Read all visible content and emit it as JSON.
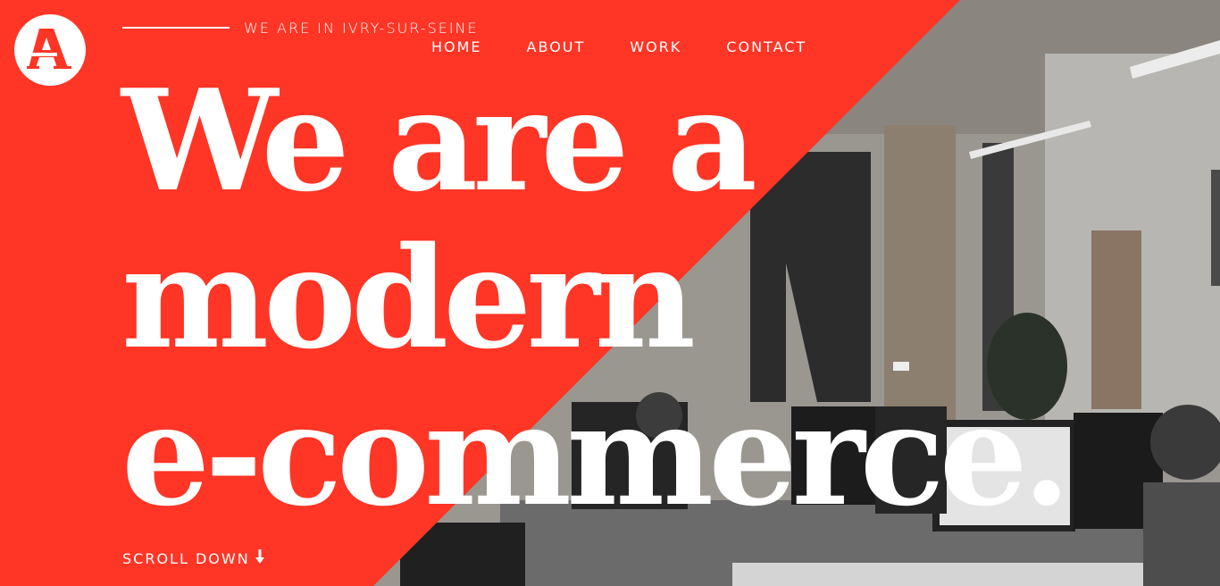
{
  "brand": {
    "logo_letter": "A"
  },
  "header": {
    "tagline": "WE ARE IN IVRY-SUR-SEINE",
    "nav": [
      {
        "label": "HOME"
      },
      {
        "label": "ABOUT"
      },
      {
        "label": "WORK"
      },
      {
        "label": "CONTACT"
      }
    ]
  },
  "hero": {
    "lines": [
      "We are a",
      "modern",
      "e-commerce."
    ]
  },
  "scroll": {
    "label": "SCROLL DOWN",
    "icon": "arrow-down-icon"
  },
  "colors": {
    "accent": "#ff3526",
    "text": "#ffffff"
  }
}
